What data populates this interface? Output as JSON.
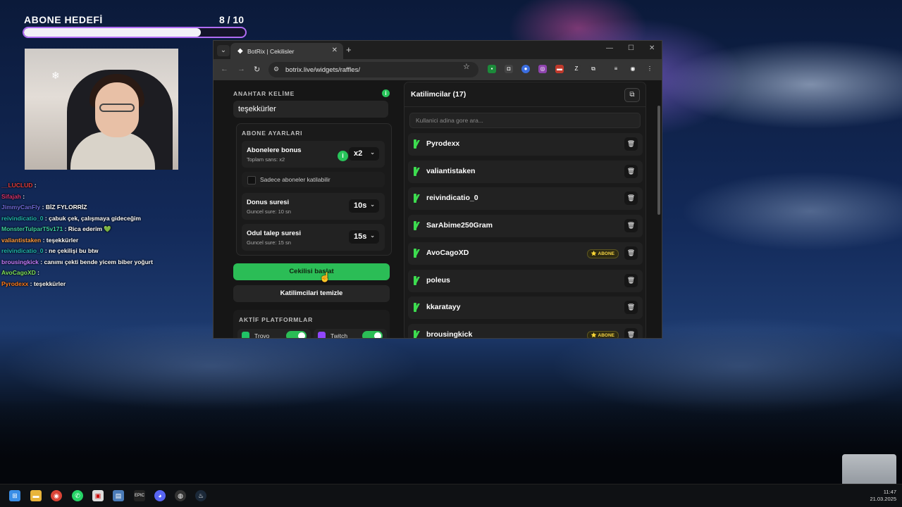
{
  "overlay": {
    "goal_title": "ABONE HEDEFİ",
    "goal_count": "8  / 10",
    "goal_progress": 0.8
  },
  "chat": [
    {
      "user": "__LUCLUD",
      "color": "#e23b3b",
      "msg": ""
    },
    {
      "user": "Sifajah",
      "color": "#d6336c",
      "msg": ""
    },
    {
      "user": "JimmyCanFly",
      "color": "#6f6ad8",
      "msg": "BİZ FYLORRİZ"
    },
    {
      "user": "reivindicatio_0",
      "color": "#20b8b0",
      "msg": "çabuk çek, çalışmaya gideceğim"
    },
    {
      "user": "MonsterTulparT5v171",
      "color": "#3fd1a0",
      "msg": "Rica ederim 💚"
    },
    {
      "user": "valiantistaken",
      "color": "#ff9a3c",
      "msg": "teşekkürler"
    },
    {
      "user": "reivindicatio_0",
      "color": "#20b8b0",
      "msg": "ne çekilişi bu btw"
    },
    {
      "user": "brousingkick",
      "color": "#c77dff",
      "msg": "canımı çekti bende yicem biber yoğurt"
    },
    {
      "user": "AvoCagoXD",
      "color": "#7ee05a",
      "msg": ""
    },
    {
      "user": "Pyrodexx",
      "color": "#ff7a1a",
      "msg": "teşekkürler"
    }
  ],
  "browser": {
    "tab_title": "BotRix | Cekilisler",
    "url": "botrix.live/widgets/raffles/"
  },
  "left_panel": {
    "keyword_label": "ANAHTAR KELİME",
    "keyword_value": "teşekkürler",
    "sub_settings_title": "ABONE AYARLARI",
    "bonus_title": "Abonelere bonus",
    "bonus_sub": "Toplam sans: x2",
    "bonus_value": "x2",
    "only_subs_label": "Sadece aboneler katilabilir",
    "donus_title": "Donus suresi",
    "donus_sub": "Guncel sure: 10 sn",
    "donus_value": "10s",
    "odul_title": "Odul talep suresi",
    "odul_sub": "Guncel sure: 15 sn",
    "odul_value": "15s",
    "start_button": "Cekilisi baslat",
    "clear_button": "Katilimcilari temizle",
    "platforms_title": "AKTİF PLATFORMLAR",
    "platforms": [
      {
        "label": "Trovo",
        "color": "#20c266",
        "enabled": true
      },
      {
        "label": "Twitch",
        "color": "#9146ff",
        "enabled": true
      }
    ]
  },
  "right_panel": {
    "title": "Katilimcilar (17)",
    "search_placeholder": "Kullanici adina gore ara...",
    "badge_label": "⭐ ABONE",
    "participants": [
      {
        "name": "Pyrodexx",
        "sub": false
      },
      {
        "name": "valiantistaken",
        "sub": false
      },
      {
        "name": "reivindicatio_0",
        "sub": false
      },
      {
        "name": "SarAbime250Gram",
        "sub": false
      },
      {
        "name": "AvoCagoXD",
        "sub": true
      },
      {
        "name": "poleus",
        "sub": false
      },
      {
        "name": "kkaratayy",
        "sub": false
      },
      {
        "name": "brousingkick",
        "sub": true
      }
    ]
  },
  "taskbar": {
    "time": "11:47",
    "date": "21.03.2025"
  }
}
